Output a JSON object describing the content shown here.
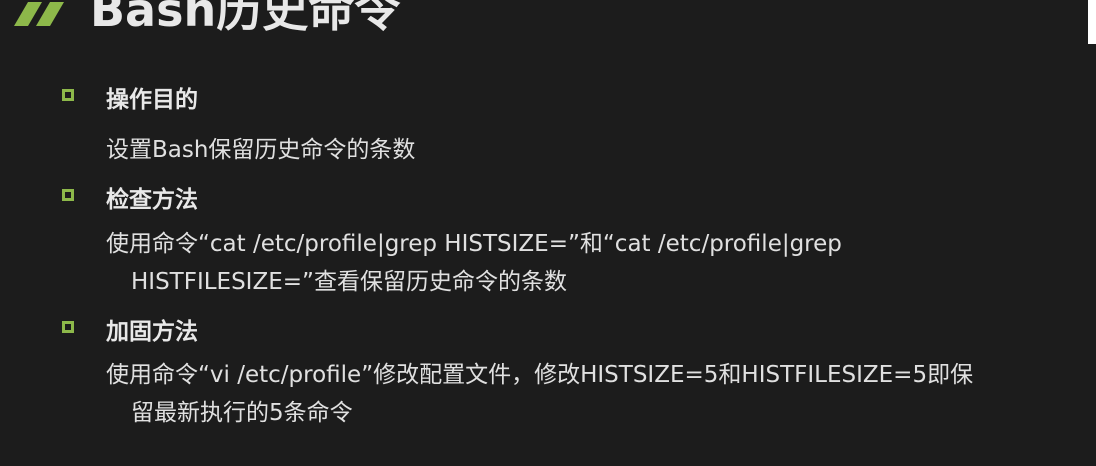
{
  "slide": {
    "title": "Bash历史命令",
    "accent_color": "#8db84a",
    "sections": [
      {
        "heading": "操作目的",
        "lines": [
          "设置Bash保留历史命令的条数"
        ]
      },
      {
        "heading": "检查方法",
        "lines": [
          "使用命令“cat /etc/profile|grep HISTSIZE=”和“cat /etc/profile|grep",
          "HISTFILESIZE=”查看保留历史命令的条数"
        ]
      },
      {
        "heading": "加固方法",
        "lines": [
          "使用命令“vi /etc/profile”修改配置文件，修改HISTSIZE=5和HISTFILESIZE=5即保",
          "留最新执行的5条命令"
        ]
      }
    ]
  }
}
